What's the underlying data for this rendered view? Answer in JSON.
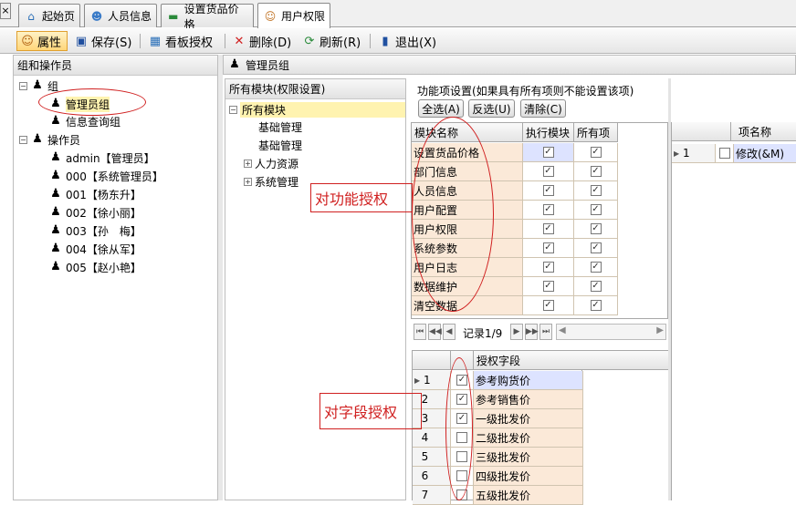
{
  "tabs": [
    {
      "label": "起始页",
      "icon": "home-icon"
    },
    {
      "label": "人员信息",
      "icon": "person-icon"
    },
    {
      "label": "设置货品价格",
      "icon": "money-icon"
    },
    {
      "label": "用户权限",
      "icon": "users-icon"
    }
  ],
  "toolbar": {
    "properties": "属性",
    "save": "保存(S)",
    "board_auth": "看板授权",
    "delete": "删除(D)",
    "refresh": "刷新(R)",
    "exit": "退出(X)"
  },
  "left": {
    "title": "组和操作员",
    "group_root": "组",
    "groups": [
      "管理员组",
      "信息查询组"
    ],
    "operator_root": "操作员",
    "operators": [
      "admin【管理员】",
      "000【系统管理员】",
      "001【杨东升】",
      "002【徐小丽】",
      "003【孙　梅】",
      "004【徐从军】",
      "005【赵小艳】"
    ]
  },
  "mid": {
    "title": "管理员组",
    "modules_title": "所有模块(权限设置)",
    "modules_root": "所有模块",
    "modules": [
      "基础管理",
      "基础管理",
      "人力资源",
      "系统管理"
    ]
  },
  "func": {
    "title": "功能项设置(如果具有所有项则不能设置该项)",
    "select_all": "全选(A)",
    "invert": "反选(U)",
    "clear": "清除(C)",
    "headers": [
      "模块名称",
      "执行模块",
      "所有项"
    ],
    "rows": [
      "设置货品价格",
      "部门信息",
      "人员信息",
      "用户配置",
      "用户权限",
      "系统参数",
      "用户日志",
      "数据维护",
      "清空数据"
    ],
    "record": "记录1/9"
  },
  "items": {
    "header": "项名称",
    "rows": [
      {
        "num": "1",
        "name": "修改(&M)"
      }
    ]
  },
  "fields": {
    "header": "授权字段",
    "rows": [
      {
        "num": "1",
        "checked": true,
        "name": "参考购货价"
      },
      {
        "num": "2",
        "checked": true,
        "name": "参考销售价"
      },
      {
        "num": "3",
        "checked": true,
        "name": "一级批发价"
      },
      {
        "num": "4",
        "checked": false,
        "name": "二级批发价"
      },
      {
        "num": "5",
        "checked": false,
        "name": "三级批发价"
      },
      {
        "num": "6",
        "checked": false,
        "name": "四级批发价"
      },
      {
        "num": "7",
        "checked": false,
        "name": "五级批发价"
      }
    ]
  },
  "annotations": {
    "func_auth": "对功能授权",
    "field_auth": "对字段授权"
  }
}
